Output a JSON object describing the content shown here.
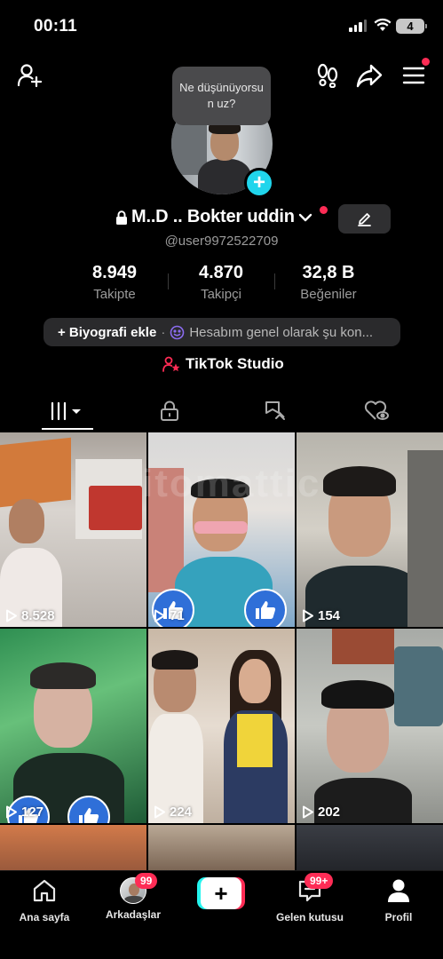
{
  "status_bar": {
    "time": "00:11",
    "battery": "4"
  },
  "profile": {
    "bubble_text": "Ne düşünüyorsun uz?",
    "name": "M..D .. Bokter uddin",
    "handle": "@user9972522709",
    "stats": [
      {
        "value": "8.949",
        "label": "Takipte"
      },
      {
        "value": "4.870",
        "label": "Takipçi"
      },
      {
        "value": "32,8 B",
        "label": "Beğeniler"
      }
    ],
    "bio_add": "+ Biyografi ekle",
    "bio_sep": "·",
    "status_text": "Hesabım genel olarak şu kon...",
    "studio": "TikTok Studio"
  },
  "grid": {
    "watermark": "itomattic",
    "videos": [
      {
        "views": "8.528"
      },
      {
        "views": "71"
      },
      {
        "views": "154"
      },
      {
        "views": "127"
      },
      {
        "views": "224"
      },
      {
        "views": "202"
      }
    ]
  },
  "bottom_nav": {
    "items": [
      {
        "label": "Ana sayfa"
      },
      {
        "label": "Arkadaşlar",
        "badge": "99"
      },
      {
        "label": "Gelen kutusu",
        "badge": "99+"
      },
      {
        "label": "Profil"
      }
    ]
  },
  "colors": {
    "accent": "#fe2c55",
    "cyan": "#25f4ee",
    "badge_blue": "#20d5ec"
  }
}
